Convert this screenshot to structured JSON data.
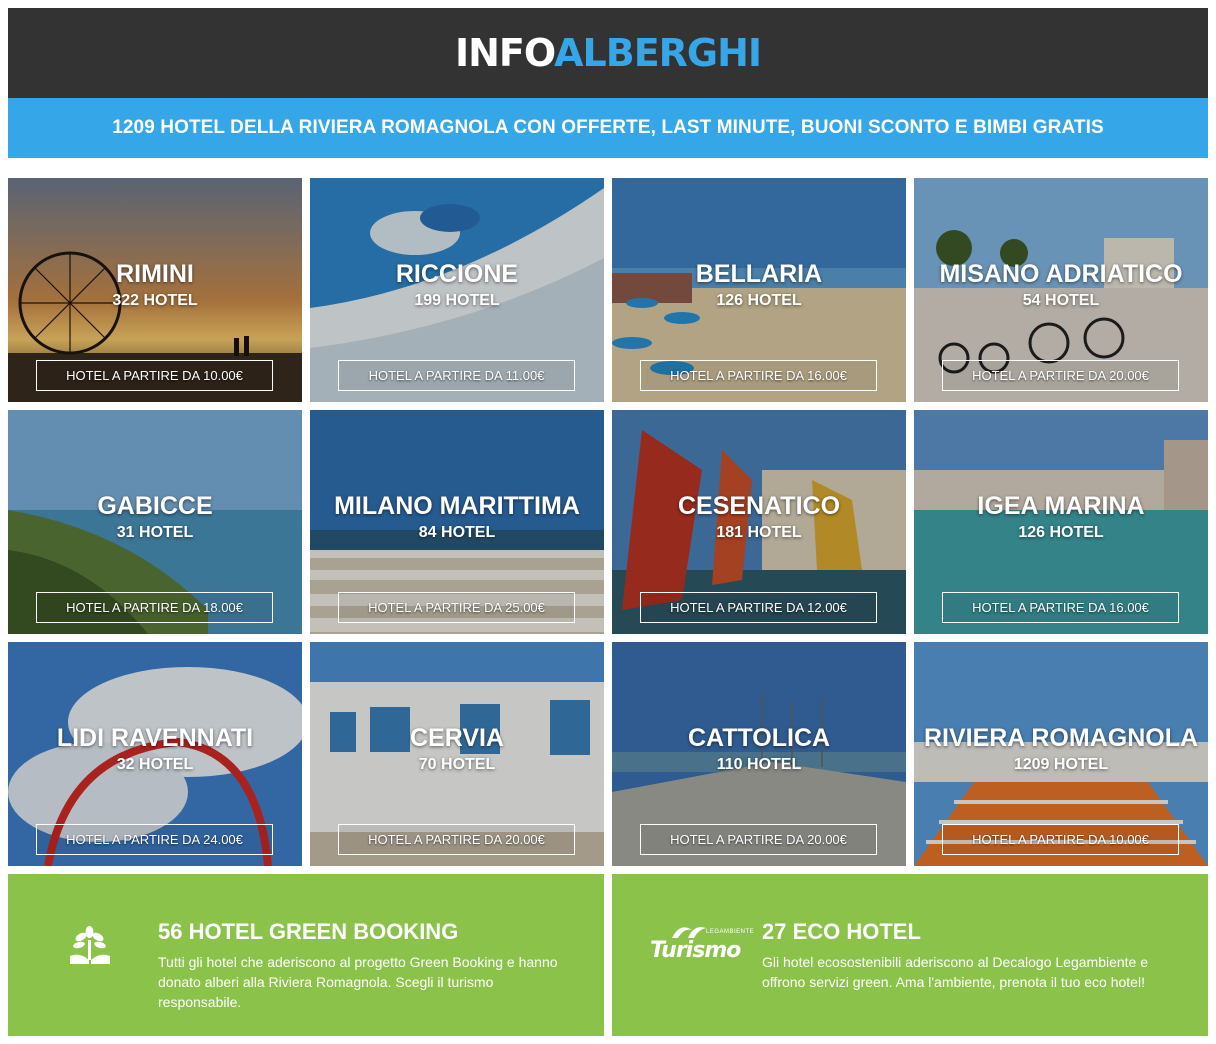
{
  "header": {
    "logo_part1": "INFO",
    "logo_part2": "ALBERGHI"
  },
  "tagline": "1209 HOTEL DELLA RIVIERA ROMAGNOLA CON OFFERTE, LAST MINUTE, BUONI SCONTO E BIMBI GRATIS",
  "tiles": [
    {
      "name": "RIMINI",
      "count": "322 HOTEL",
      "price": "HOTEL A PARTIRE DA 10.00€"
    },
    {
      "name": "RICCIONE",
      "count": "199 HOTEL",
      "price": "HOTEL A PARTIRE DA 11.00€"
    },
    {
      "name": "BELLARIA",
      "count": "126 HOTEL",
      "price": "HOTEL A PARTIRE DA 16.00€"
    },
    {
      "name": "MISANO ADRIATICO",
      "count": "54 HOTEL",
      "price": "HOTEL A PARTIRE DA 20.00€"
    },
    {
      "name": "GABICCE",
      "count": "31 HOTEL",
      "price": "HOTEL A PARTIRE DA 18.00€"
    },
    {
      "name": "MILANO MARITTIMA",
      "count": "84 HOTEL",
      "price": "HOTEL A PARTIRE DA 25.00€"
    },
    {
      "name": "CESENATICO",
      "count": "181 HOTEL",
      "price": "HOTEL A PARTIRE DA 12.00€"
    },
    {
      "name": "IGEA MARINA",
      "count": "126 HOTEL",
      "price": "HOTEL A PARTIRE DA 16.00€"
    },
    {
      "name": "LIDI RAVENNATI",
      "count": "32 HOTEL",
      "price": "HOTEL A PARTIRE DA 24.00€"
    },
    {
      "name": "CERVIA",
      "count": "70 HOTEL",
      "price": "HOTEL A PARTIRE DA 20.00€"
    },
    {
      "name": "CATTOLICA",
      "count": "110 HOTEL",
      "price": "HOTEL A PARTIRE DA 20.00€"
    },
    {
      "name": "RIVIERA ROMAGNOLA",
      "count": "1209 HOTEL",
      "price": "HOTEL A PARTIRE DA 10.00€"
    }
  ],
  "green_booking": {
    "icon": "tree-hands-icon",
    "title": "56 HOTEL GREEN BOOKING",
    "text": "Tutti gli hotel che aderiscono al progetto Green Booking e hanno donato alberi alla Riviera Romagnola. Scegli il turismo responsabile."
  },
  "eco_hotel": {
    "icon": "legambiente-turismo-logo",
    "logo_word": "Turismo",
    "logo_small": "LEGAMBIENTE",
    "title": "27 ECO HOTEL",
    "text": "Gli hotel ecosostenibili aderiscono al Decalogo Legambiente e offrono servizi green. Ama l'ambiente, prenota il tuo eco hotel!"
  },
  "colors": {
    "header_bg": "#333333",
    "accent_blue": "#35a7e8",
    "green": "#8bc34a"
  }
}
